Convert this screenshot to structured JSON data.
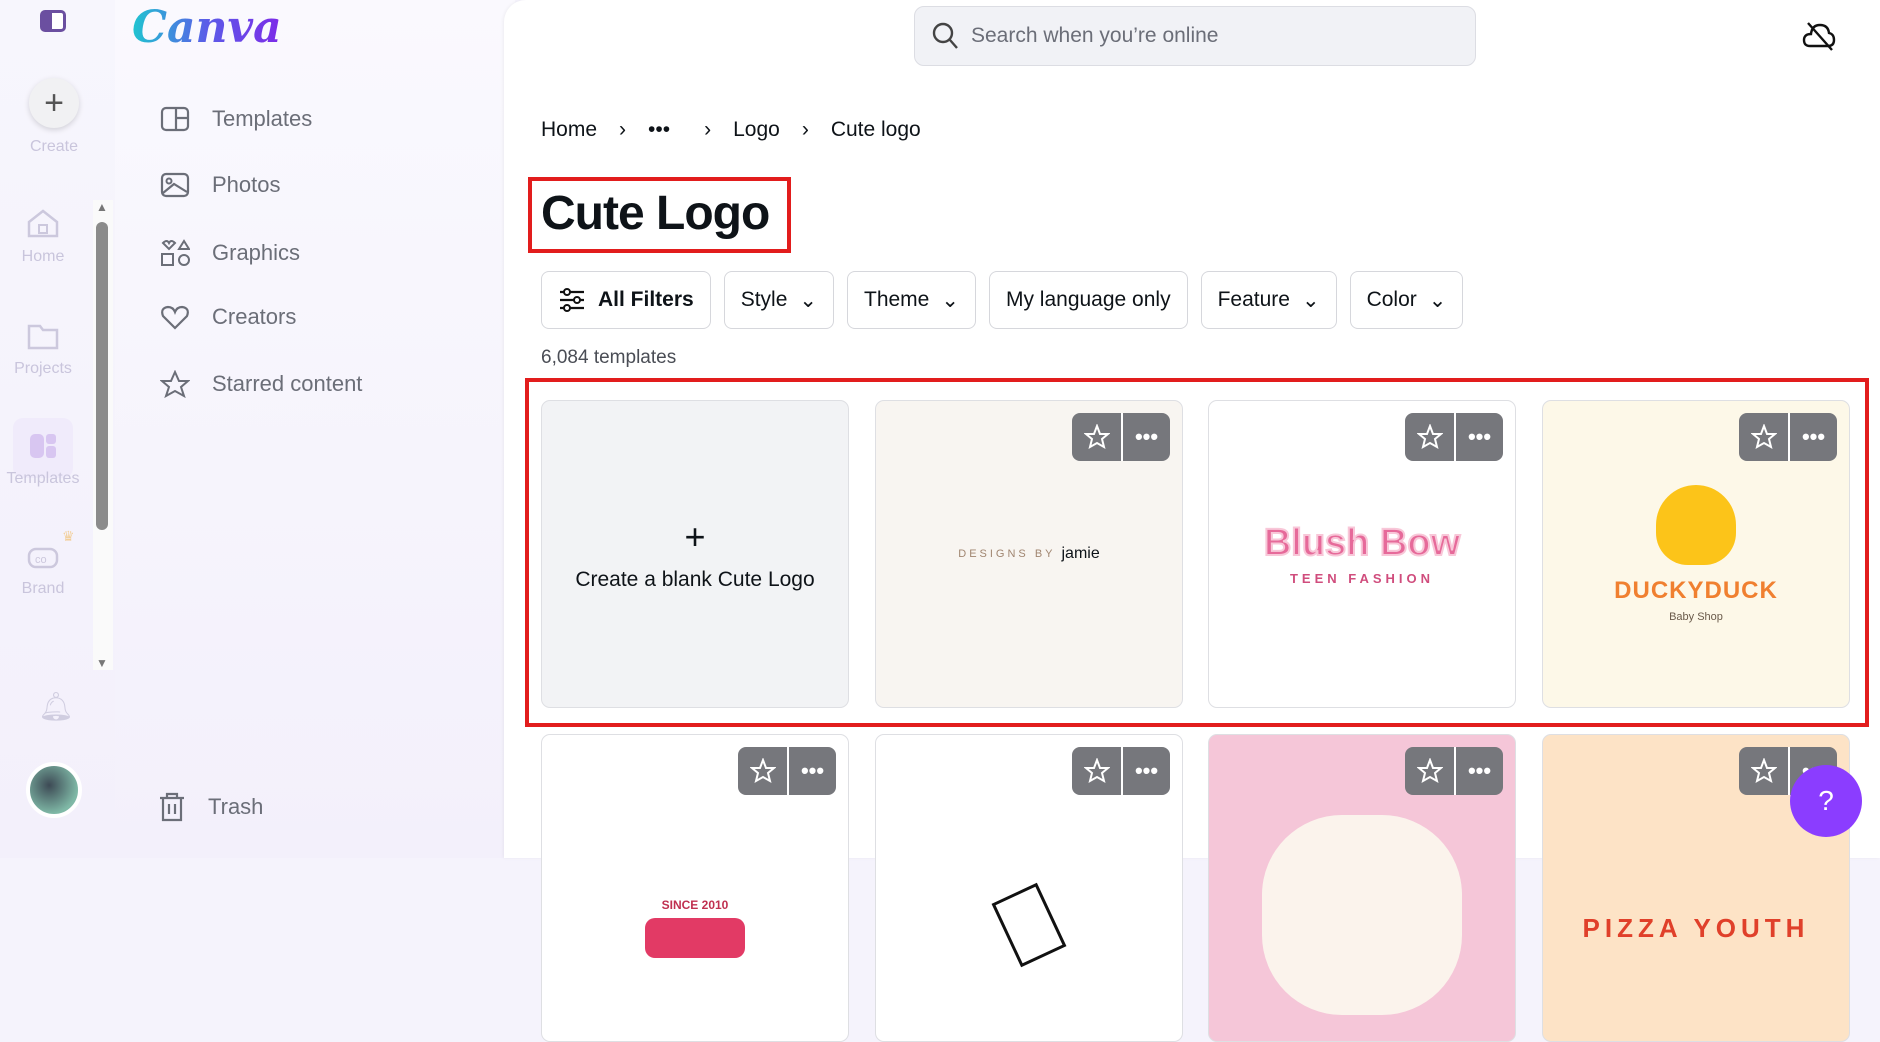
{
  "rail": {
    "create": "Create",
    "items": [
      {
        "label": "Home"
      },
      {
        "label": "Projects"
      },
      {
        "label": "Templates"
      },
      {
        "label": "Brand"
      }
    ]
  },
  "logo": "Canva",
  "panel": {
    "items": [
      {
        "label": "Templates",
        "icon": "template-icon"
      },
      {
        "label": "Photos",
        "icon": "photo-icon"
      },
      {
        "label": "Graphics",
        "icon": "shapes-icon"
      },
      {
        "label": "Creators",
        "icon": "heart-icon"
      },
      {
        "label": "Starred content",
        "icon": "star-icon"
      }
    ],
    "trash": "Trash"
  },
  "search": {
    "placeholder": "Search when you’re online"
  },
  "breadcrumb": [
    "Home",
    "•••",
    "Logo",
    "Cute logo"
  ],
  "title": "Cute Logo",
  "filters": {
    "all": "All Filters",
    "items": [
      "Style",
      "Theme",
      "My language only",
      "Feature",
      "Color"
    ]
  },
  "count": "6,084 templates",
  "blank_card": {
    "label": "Create a blank Cute Logo"
  },
  "templates": [
    {
      "line1": "DESIGNS BY",
      "line2": "jamie",
      "bg": "#f8f5f1"
    },
    {
      "line1": "Blush Bow",
      "line2": "TEEN FASHION",
      "bg": "#ffffff"
    },
    {
      "line1": "DUCKYDUCK",
      "line2": "Baby Shop",
      "bg": "#fdf8e8"
    },
    {
      "line1": "SINCE 2010",
      "bg": "#ffffff"
    },
    {
      "line1": "",
      "bg": "#ffffff"
    },
    {
      "line1": "",
      "bg": "#f5c6d8"
    },
    {
      "line1": "PIZZA YOUTH",
      "bg": "#fde3c6"
    }
  ],
  "help": "?"
}
